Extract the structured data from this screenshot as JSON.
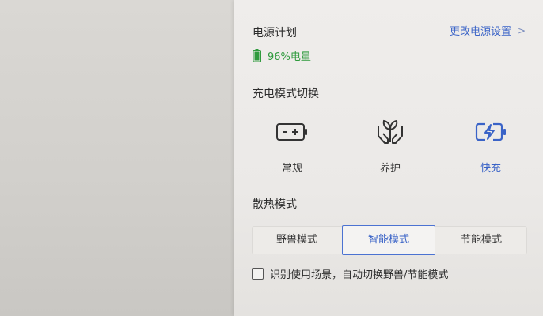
{
  "power_plan": {
    "title": "电源计划",
    "battery_text": "96%电量",
    "battery_level": 0.96,
    "change_link": "更改电源设置",
    "change_link_chevron": ">"
  },
  "charging": {
    "title": "充电模式切换",
    "modes": [
      {
        "label": "常规",
        "icon": "battery-icon",
        "active": false
      },
      {
        "label": "养护",
        "icon": "leaf-hands-icon",
        "active": false
      },
      {
        "label": "快充",
        "icon": "fast-charge-icon",
        "active": true
      }
    ]
  },
  "cooling": {
    "title": "散热模式",
    "options": [
      {
        "label": "野兽模式",
        "active": false
      },
      {
        "label": "智能模式",
        "active": true
      },
      {
        "label": "节能模式",
        "active": false
      }
    ],
    "auto_switch_label": "识别使用场景，自动切换野兽/节能模式",
    "auto_switch_checked": false
  },
  "colors": {
    "accent": "#3a63c7",
    "battery_green": "#2f9a3d",
    "panel_bg": "#edebe9"
  }
}
